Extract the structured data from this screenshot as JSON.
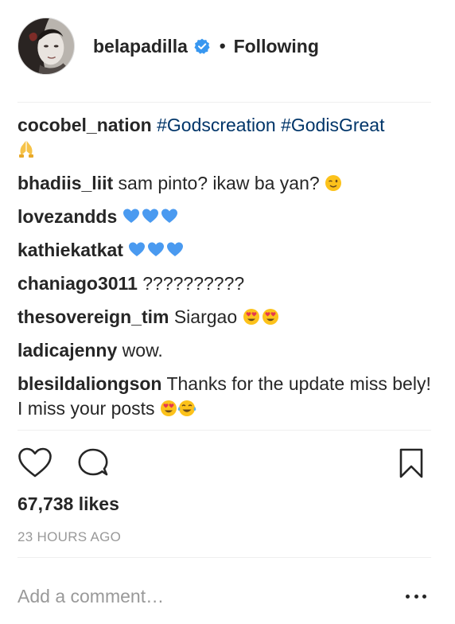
{
  "post": {
    "username": "belapadilla",
    "separator": "•",
    "follow_status": "Following"
  },
  "comments": [
    {
      "user": "cocobel_nation",
      "text": "#Godscreation #GodisGreat",
      "emojis": [
        "folded-hands"
      ]
    },
    {
      "user": "bhadiis_liit",
      "text": "sam pinto? ikaw ba yan?",
      "emojis": [
        "winking-face"
      ]
    },
    {
      "user": "lovezandds",
      "text": "",
      "emojis": [
        "blue-heart",
        "blue-heart",
        "blue-heart"
      ]
    },
    {
      "user": "kathiekatkat",
      "text": "",
      "emojis": [
        "blue-heart",
        "blue-heart",
        "blue-heart"
      ]
    },
    {
      "user": "chaniago3011",
      "text": "??????????",
      "emojis": []
    },
    {
      "user": "thesovereign_tim",
      "text": "Siargao",
      "emojis": [
        "heart-eyes-face",
        "heart-eyes-face"
      ]
    },
    {
      "user": "ladicajenny",
      "text": "wow.",
      "emojis": []
    },
    {
      "user": "blesildaliongson",
      "text": "Thanks for the update miss bely! I miss your posts",
      "emojis": [
        "heart-eyes-face",
        "tears-of-joy-face"
      ]
    }
  ],
  "likes": "67,738 likes",
  "timestamp": "23 HOURS AGO",
  "add_comment": {
    "placeholder": "Add a comment…"
  },
  "colors": {
    "hashtag": "#003569",
    "verified": "#3897f0",
    "muted": "#999999",
    "text": "#262626"
  },
  "icons": [
    "heart-icon",
    "comment-icon",
    "bookmark-icon",
    "more-options-icon",
    "verified-badge-icon"
  ]
}
